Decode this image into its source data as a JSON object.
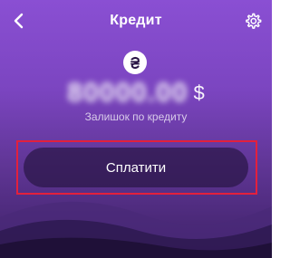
{
  "header": {
    "title": "Кредит",
    "back_icon": "chevron-left-icon",
    "settings_icon": "gear-icon"
  },
  "balance": {
    "amount": "80000.00",
    "currency": "$",
    "caption": "Залишок по кредиту",
    "logo_icon": "hryvnia-coin-icon"
  },
  "actions": {
    "pay_label": "Сплатити"
  },
  "colors": {
    "accent_frame": "#e3203d",
    "background_top": "#8a4fd3",
    "background_bottom": "#3d2166"
  }
}
